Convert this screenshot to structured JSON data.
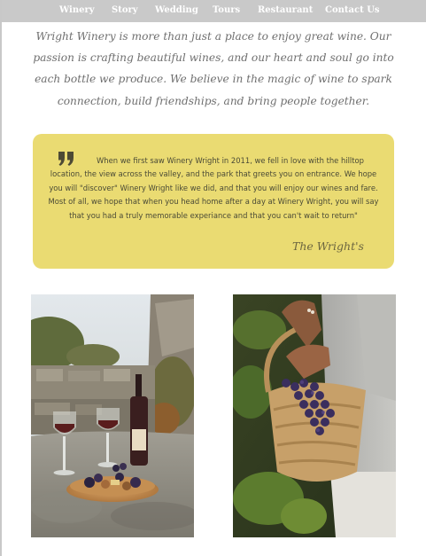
{
  "nav": {
    "items": [
      {
        "label": "Winery"
      },
      {
        "label": "Story"
      },
      {
        "label": "Wedding"
      },
      {
        "label": "Tours"
      },
      {
        "label": "Restaurant"
      },
      {
        "label": "Contact Us"
      }
    ]
  },
  "intro": {
    "text": "Wright Winery is more than just a place to enjoy great wine. Our passion is crafting beautiful wines, and our heart and soul go into each bottle we produce. We believe in the magic of wine to spark connection, build friendships, and bring people together."
  },
  "testimonial": {
    "quote": "When we first saw Winery Wright in 2011, we fell in love with the hilltop location, the view across the valley, and the park that greets you on entrance. We hope you will \"discover\" Winery Wright like we did, and that you will enjoy our wines and fare. Most of all, we hope that when you head home after a day at Winery Wright, you will say that you had a truly memorable experiance and that you can't wait to return\"",
    "signature": "The Wright's"
  },
  "colors": {
    "nav_background": "#c9c9c9",
    "card_background": "#eadb72",
    "intro_text": "#6f6f6f"
  },
  "gallery": {
    "images": [
      {
        "icon": "wine-picnic-photo"
      },
      {
        "icon": "grape-harvest-photo"
      }
    ]
  }
}
